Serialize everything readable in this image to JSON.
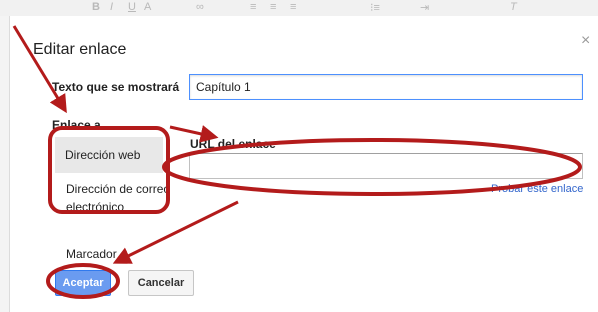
{
  "dialog": {
    "title": "Editar enlace",
    "close_glyph": "×",
    "display_text_label": "Texto que se mostrará",
    "display_text_value": "Capítulo 1",
    "link_to_label": "Enlace a",
    "options": [
      {
        "label": "Dirección web"
      },
      {
        "label": "Dirección de correo electrónico"
      },
      {
        "label": "Marcador"
      }
    ],
    "url_label": "URL del enlace",
    "url_value": "",
    "test_link": "Probar este enlace",
    "accept_button": "Aceptar",
    "cancel_button": "Cancelar"
  },
  "colors": {
    "annotation": "#b31b1b",
    "accent_blue": "#4d90fe",
    "link_blue": "#3366cc"
  }
}
